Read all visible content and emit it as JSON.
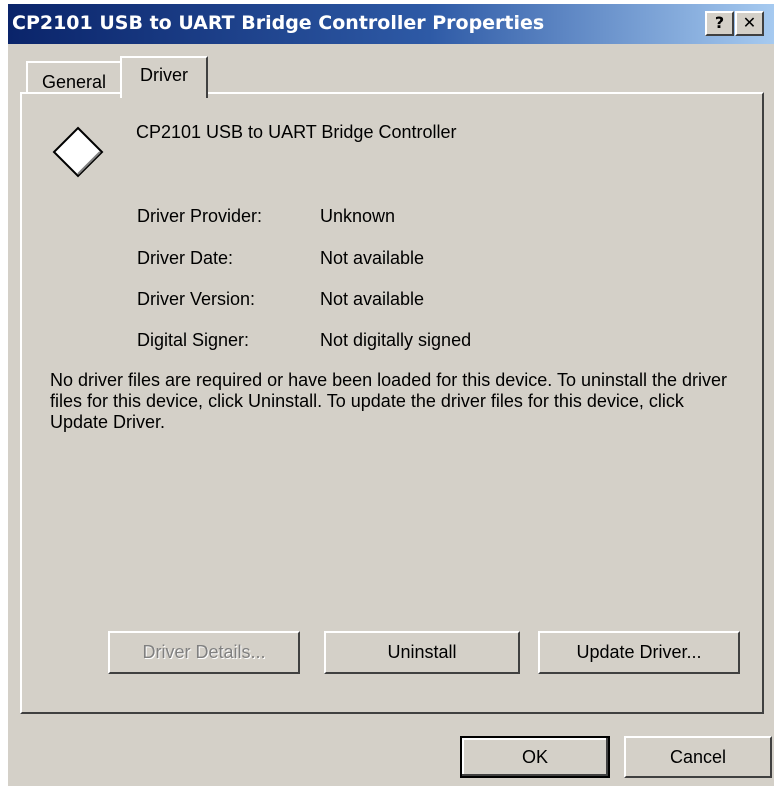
{
  "window": {
    "title": "CP2101 USB to UART Bridge Controller Properties",
    "help_button": "?",
    "close_button": "✕"
  },
  "tabs": [
    {
      "label": "General",
      "selected": false
    },
    {
      "label": "Driver",
      "selected": true
    }
  ],
  "device": {
    "icon": "device-icon",
    "name": "CP2101 USB to UART Bridge Controller"
  },
  "properties": [
    {
      "label": "Driver Provider:",
      "value": "Unknown"
    },
    {
      "label": "Driver Date:",
      "value": "Not available"
    },
    {
      "label": "Driver Version:",
      "value": "Not available"
    },
    {
      "label": "Digital Signer:",
      "value": "Not digitally signed"
    }
  ],
  "info_text": "No driver files are required or have been loaded for this device. To uninstall the driver files for this device, click Uninstall. To update the driver files for this device, click Update Driver.",
  "buttons": {
    "driver_details": "Driver Details...",
    "uninstall": "Uninstall",
    "update_driver": "Update Driver...",
    "ok": "OK",
    "cancel": "Cancel"
  },
  "colors": {
    "titlebar_start": "#0a246a",
    "titlebar_end": "#a6caf0",
    "window_bg": "#d4d0c8"
  }
}
